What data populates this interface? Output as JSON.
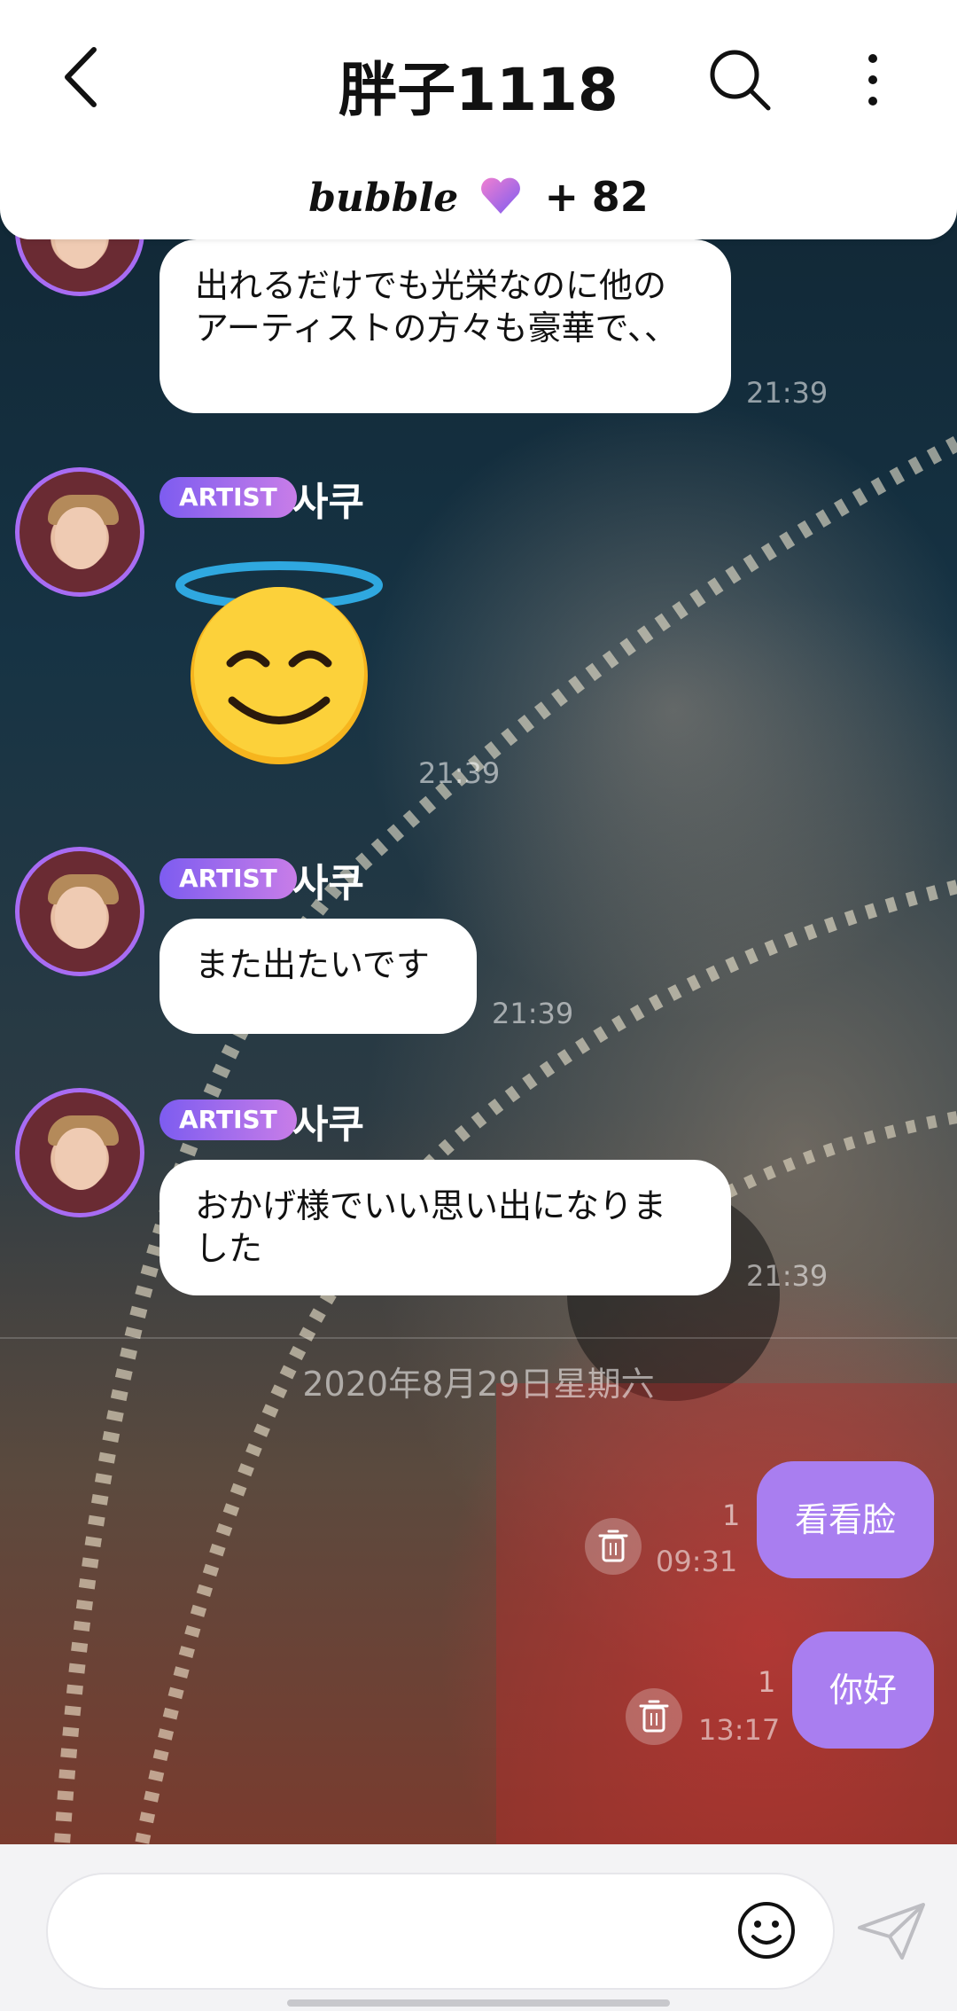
{
  "header": {
    "title": "胖子1118",
    "bubble_logo": "bubble",
    "bubble_plus": "+",
    "bubble_count": "82"
  },
  "messages": [
    {
      "sender": "",
      "badge": "",
      "text": "出れるだけでも光栄なのに他のアーティストの方々も豪華で、、",
      "time": "21:39"
    },
    {
      "sender": "사쿠",
      "badge": "ARTIST",
      "emoji": "smiling-face-with-halo",
      "time": "21:39"
    },
    {
      "sender": "사쿠",
      "badge": "ARTIST",
      "text": "また出たいです",
      "time": "21:39"
    },
    {
      "sender": "사쿠",
      "badge": "ARTIST",
      "text": "おかげ様でいい思い出になりました",
      "time": "21:39"
    }
  ],
  "date_separator": "2020年8月29日星期六",
  "my_messages": [
    {
      "text": "看看脸",
      "time": "09:31",
      "unread": "1"
    },
    {
      "text": "你好",
      "time": "13:17",
      "unread": "1"
    }
  ],
  "input": {
    "placeholder": ""
  },
  "icons": {
    "back": "chevron-left-icon",
    "search": "search-icon",
    "more": "more-vertical-icon",
    "emoji": "smiley-icon",
    "send": "paper-plane-icon",
    "trash": "trash-icon"
  },
  "colors": {
    "accent": "#a97ef0",
    "badge_start": "#7d5cf0",
    "badge_end": "#c87de8"
  }
}
